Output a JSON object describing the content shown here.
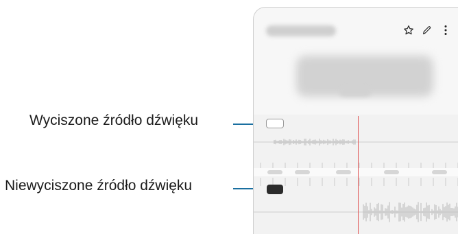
{
  "callouts": {
    "muted_source": "Wyciszone źródło dźwięku",
    "unmuted_source": "Niewyciszone źródło dźwięku"
  },
  "toolbar": {
    "icons": [
      "star-icon",
      "edit-icon",
      "more-icon"
    ]
  },
  "colors": {
    "leader_line": "#1a6fa0",
    "playhead": "#e05a5a",
    "waveform": "#b8b8b8"
  }
}
